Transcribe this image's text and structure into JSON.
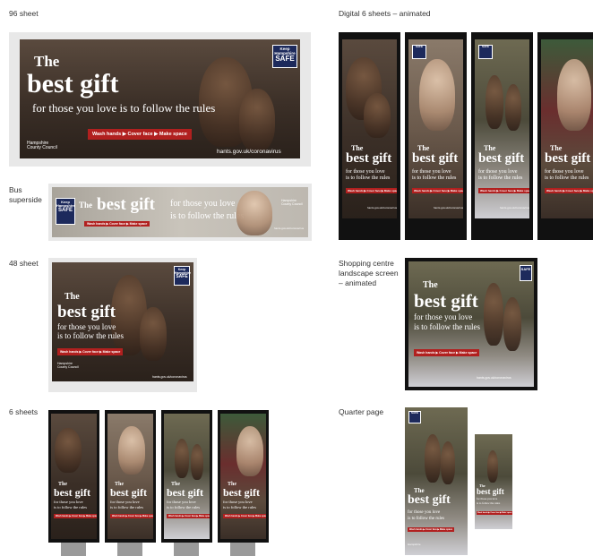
{
  "labels": {
    "s96": "96 sheet",
    "digital": "Digital 6 sheets – animated",
    "bus": "Bus",
    "bus2": "superside",
    "s48": "48 sheet",
    "shop1": "Shopping centre",
    "shop2": "landscape screen",
    "shop3": "– animated",
    "s6": "6 sheets",
    "quarter": "Quarter page"
  },
  "ad": {
    "the": "The",
    "best_gift": "best gift",
    "line1": "for those you love",
    "line2": "is to follow the rules",
    "line_full": "for those you love is to follow the rules",
    "rules": "Wash hands ▶ Cover face ▶ Make space",
    "url": "hants.gov.uk/coronavirus",
    "keep": "Keep",
    "hampshire": "Hampshire",
    "safe": "SAFE",
    "council1": "Hampshire",
    "council2": "County Council"
  }
}
